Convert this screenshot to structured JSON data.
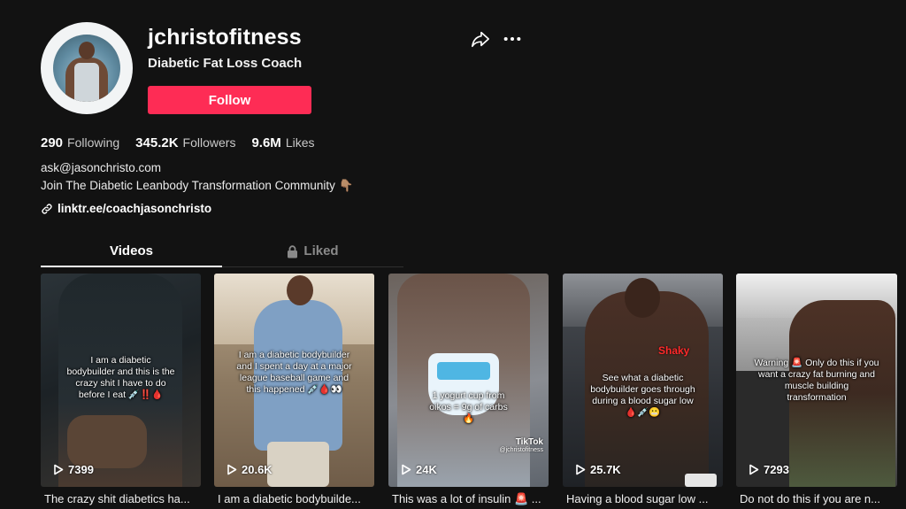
{
  "profile": {
    "username": "jchristofitness",
    "subtitle": "Diabetic Fat Loss Coach",
    "follow_label": "Follow"
  },
  "stats": {
    "following_count": "290",
    "following_label": "Following",
    "followers_count": "345.2K",
    "followers_label": "Followers",
    "likes_count": "9.6M",
    "likes_label": "Likes"
  },
  "bio": {
    "email": "ask@jasonchristo.com",
    "line2": "Join The Diabetic Leanbody Transformation Community",
    "line2_emoji": "👇🏽",
    "link": "linktr.ee/coachjasonchristo"
  },
  "tabs": {
    "videos": "Videos",
    "liked": "Liked"
  },
  "videos": [
    {
      "overlay": "I am a diabetic bodybuilder and this is the crazy shit I have to do before I eat 💉‼️🩸",
      "views": "7399",
      "caption": "The crazy shit diabetics ha..."
    },
    {
      "overlay": "I am a diabetic bodybuilder and I spent a day at a major league baseball game and this happened 💉🩸👀",
      "views": "20.6K",
      "caption": "I am a diabetic bodybuilde..."
    },
    {
      "overlay": "1 yogurt cup from oikos = 9g of carbs🔥",
      "views": "24K",
      "caption": "This was a lot of insulin 🚨 ...",
      "watermark": "TikTok",
      "watermark_handle": "@jchristofitness"
    },
    {
      "overlay": "See what a diabetic bodybuilder goes through during a blood sugar low 🩸💉😬",
      "label": "Shaky",
      "views": "25.7K",
      "caption": "Having a blood sugar low ..."
    },
    {
      "overlay": "Warning 🚨 Only do this if you want a crazy fat burning and muscle building transformation",
      "views": "7293",
      "caption": "Do not do this if you are n..."
    }
  ],
  "icons": {
    "share": "share-icon",
    "more": "more-icon",
    "link": "link-icon",
    "lock": "lock-icon",
    "play": "play-icon"
  },
  "colors": {
    "background": "#121212",
    "accent": "#fe2c55"
  }
}
